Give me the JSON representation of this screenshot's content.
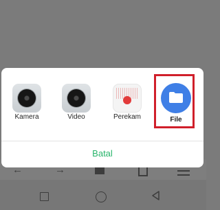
{
  "share_sheet": {
    "apps": [
      {
        "label": "Kamera",
        "icon": "camera-icon"
      },
      {
        "label": "Video",
        "icon": "video-camera-icon"
      },
      {
        "label": "Perekam",
        "icon": "recorder-icon"
      },
      {
        "label": "File",
        "icon": "folder-icon"
      }
    ],
    "cancel_label": "Batal"
  },
  "colors": {
    "accent_green": "#27b46a",
    "highlight_red": "#d01f2a",
    "file_blue": "#3f7fe6",
    "record_red": "#e23b3b"
  }
}
